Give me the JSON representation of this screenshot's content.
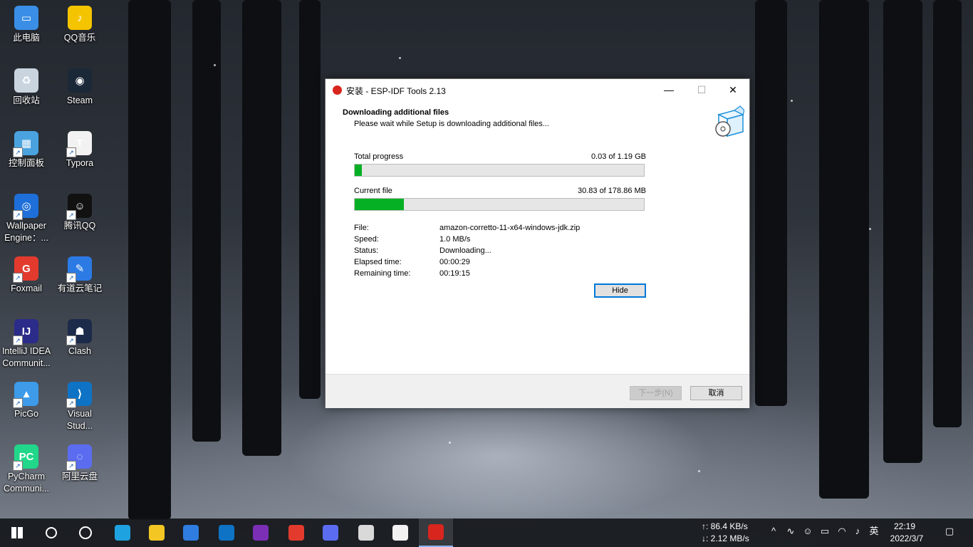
{
  "desktop": {
    "icons": [
      {
        "label": "此电脑",
        "color": "#3a8ee6",
        "glyph": "▭"
      },
      {
        "label": "QQ音乐",
        "color": "#f5c400",
        "glyph": "♪"
      },
      {
        "label": "回收站",
        "color": "#c9d4df",
        "glyph": "♻"
      },
      {
        "label": "Steam",
        "color": "#1b2838",
        "glyph": "◉"
      },
      {
        "label": "控制面板",
        "color": "#4aa3df",
        "glyph": "▦"
      },
      {
        "label": "Typora",
        "color": "#f2f2f2",
        "glyph": "T"
      },
      {
        "label": "Wallpaper\nEngine：...",
        "color": "#1e6fd9",
        "glyph": "◎"
      },
      {
        "label": "腾讯QQ",
        "color": "#111111",
        "glyph": "☺"
      },
      {
        "label": "Foxmail",
        "color": "#e23b2e",
        "glyph": "G"
      },
      {
        "label": "有道云笔记",
        "color": "#2c7be5",
        "glyph": "✎"
      },
      {
        "label": "IntelliJ IDEA\nCommunit...",
        "color": "#2b2b8a",
        "glyph": "IJ"
      },
      {
        "label": "Clash",
        "color": "#1d2b4a",
        "glyph": "☗"
      },
      {
        "label": "PicGo",
        "color": "#3d9be9",
        "glyph": "▲"
      },
      {
        "label": "Visual\nStud...",
        "color": "#0e73c4",
        "glyph": "⟩"
      },
      {
        "label": "PyCharm\nCommuni...",
        "color": "#21d789",
        "glyph": "PC"
      },
      {
        "label": "阿里云盘",
        "color": "#5b6cf0",
        "glyph": "◌"
      }
    ]
  },
  "window": {
    "title": "安装 - ESP-IDF Tools 2.13",
    "controls": {
      "minimize": "—",
      "maximize": "☐",
      "close": "✕"
    },
    "header_title": "Downloading additional files",
    "header_subtitle": "Please wait while Setup is downloading additional files...",
    "total": {
      "label": "Total progress",
      "value": "0.03 of 1.19 GB",
      "fraction": 0.025
    },
    "current": {
      "label": "Current file",
      "value": "30.83 of 178.86 MB",
      "fraction": 0.17
    },
    "details": [
      {
        "key": "File:",
        "value": "amazon-corretto-11-x64-windows-jdk.zip"
      },
      {
        "key": "Speed:",
        "value": "1.0 MB/s"
      },
      {
        "key": "Status:",
        "value": "Downloading..."
      },
      {
        "key": "Elapsed time:",
        "value": "00:00:29"
      },
      {
        "key": "Remaining time:",
        "value": "00:19:15"
      }
    ],
    "hide_label": "Hide",
    "next_label": "下一步(N)",
    "cancel_label": "取消"
  },
  "taskbar": {
    "items": [
      {
        "name": "windows-start",
        "color": "#ffffff"
      },
      {
        "name": "search",
        "color": "#ffffff"
      },
      {
        "name": "task-view",
        "color": "#ffffff"
      },
      {
        "name": "edge",
        "color": "#1fa3e0"
      },
      {
        "name": "file-explorer",
        "color": "#f3c623"
      },
      {
        "name": "store",
        "color": "#2f7de1"
      },
      {
        "name": "vscode",
        "color": "#0e73c4"
      },
      {
        "name": "onenote",
        "color": "#7a2fb5"
      },
      {
        "name": "foxmail",
        "color": "#e23b2e"
      },
      {
        "name": "aliyun-drive",
        "color": "#5b6cf0"
      },
      {
        "name": "chrome-like",
        "color": "#d9d9d9"
      },
      {
        "name": "typora",
        "color": "#f2f2f2"
      },
      {
        "name": "esp-idf-setup",
        "color": "#d8261e"
      }
    ],
    "net_up": "↑: 86.4 KB/s",
    "net_down": "↓: 2.12 MB/s",
    "ime": "英",
    "time": "22:19",
    "date": "2022/3/7"
  }
}
